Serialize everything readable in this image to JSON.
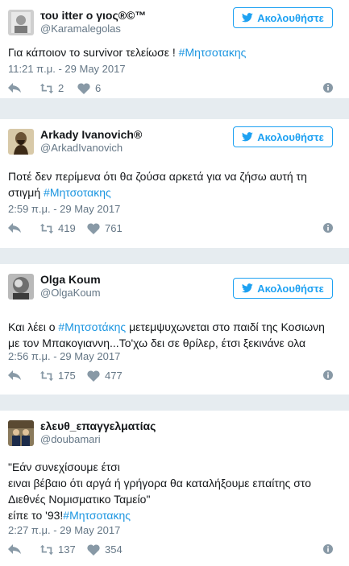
{
  "follow_label": "Ακολουθήστε",
  "tweets": [
    {
      "display_name": "του itter ο γιος®©™",
      "handle": "@Karamalegolas",
      "text_parts": [
        "Για κάποιον το survivor τελείωσε ! ",
        "#Μητσοτακης"
      ],
      "timestamp": "11:21 π.μ. - 29 May 2017",
      "retweets": "2",
      "likes": "6"
    },
    {
      "display_name": "Arkady Ivanovich®",
      "handle": "@ArkadIvanovich",
      "text_line1": "Ποτέ δεν περίμενα ότι θα ζούσα αρκετά για να ζήσω αυτή τη",
      "text_line2_prefix": "στιγμή ",
      "text_line2_tag": "#Μητσοτακης",
      "timestamp": "2:59 π.μ. - 29 May 2017",
      "retweets": "419",
      "likes": "761"
    },
    {
      "display_name": "Olga Koum",
      "handle": "@OlgaKoum",
      "text_line1_prefix": "Και λέει ο ",
      "text_line1_tag": "#Μητσοτάκης",
      "text_line1_suffix": " μετεμψυχωνεται στο παιδί της Κοσιωνη",
      "text_line2": "με τον Μπακογιαννη...Το'χω δει σε θρίλερ, έτσι ξεκινάνε ολα",
      "timestamp": "2:56 π.μ. - 29 May 2017",
      "retweets": "175",
      "likes": "477"
    },
    {
      "display_name": "ελευθ_επαγγελματίας",
      "handle": "@doubamari",
      "text_line1": "\"Εάν συνεχίσουμε έτσι",
      "text_line2": "ειναι βέβαιο ότι αργά ή γρήγορα θα καταλήξουμε επαίτης στο",
      "text_line3": "Διεθνές Νομισματικο Ταμείο\"",
      "text_line4_prefix": "είπε το '93!",
      "text_line4_tag": "#Μητσοτακης",
      "timestamp": "2:27 π.μ. - 29 May 2017",
      "retweets": "137",
      "likes": "354"
    }
  ],
  "colors": {
    "accent": "#1da1f2",
    "hashtag": "#1b95e0",
    "muted": "#657786",
    "separator": "#e6ecf0"
  },
  "icons": {
    "reply": "reply-icon",
    "retweet": "retweet-icon",
    "like": "heart-icon",
    "info": "info-icon",
    "follow": "twitter-bird-icon"
  }
}
